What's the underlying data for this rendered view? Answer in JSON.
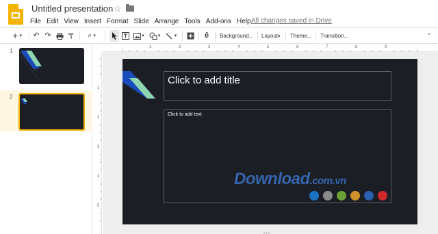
{
  "app": {
    "title": "Untitled presentation",
    "saved_status": "All changes saved in Drive"
  },
  "menu": [
    "File",
    "Edit",
    "View",
    "Insert",
    "Format",
    "Slide",
    "Arrange",
    "Tools",
    "Add-ons",
    "Help"
  ],
  "toolbar": {
    "background_label": "Background...",
    "layout_label": "Layout",
    "theme_label": "Theme...",
    "transition_label": "Transition..."
  },
  "filmstrip": {
    "slides": [
      {
        "number": "1"
      },
      {
        "number": "2"
      }
    ]
  },
  "ruler": {
    "top": [
      "1",
      "2",
      "3",
      "4",
      "5",
      "6",
      "7",
      "8",
      "9"
    ],
    "left": [
      "1",
      "2",
      "3",
      "4",
      "5"
    ]
  },
  "slide": {
    "title_placeholder": "Click to add title",
    "body_placeholder": "Click to add text"
  },
  "watermark": {
    "main": "Download",
    "domain": ".com.vn"
  },
  "colors": {
    "slide_background": "#1c1e26",
    "accent_blue": "#1a4bbd",
    "accent_mint": "#8fd6b2",
    "selection": "#f4b400",
    "watermark_dots": [
      "#1a74c4",
      "#8a8a8a",
      "#6aa336",
      "#d0922c",
      "#2a5fae",
      "#cc2a2a"
    ]
  }
}
